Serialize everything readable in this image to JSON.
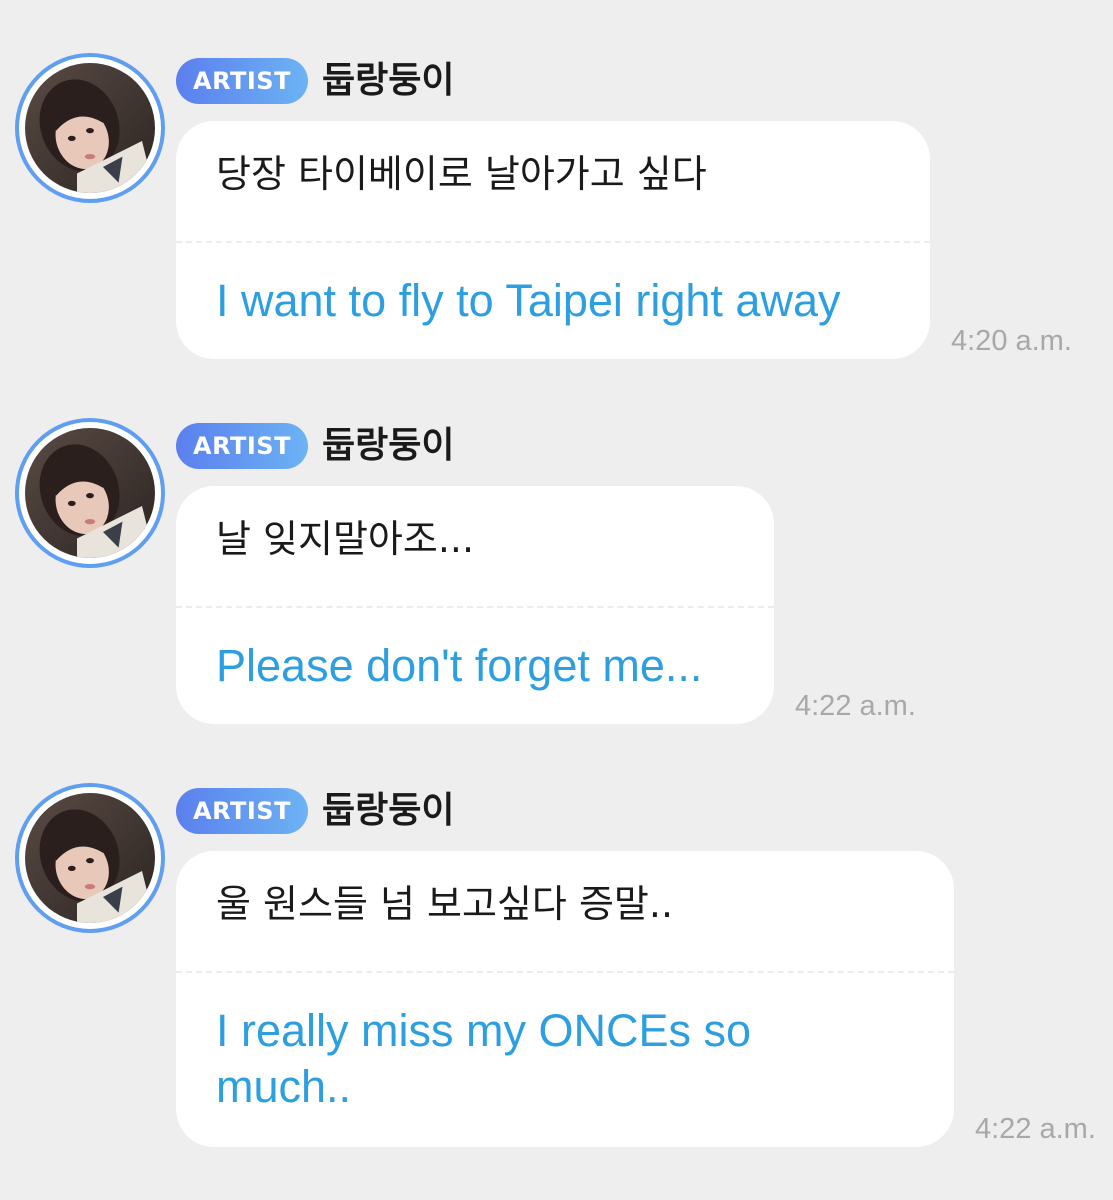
{
  "colors": {
    "background": "#eeeeee",
    "bubble": "#ffffff",
    "translation_text": "#2d9fe0",
    "timestamp": "#a8a8a8",
    "badge_gradient_start": "#5b7fee",
    "badge_gradient_end": "#6cb3f4",
    "avatar_ring": "#5f9ef0"
  },
  "messages": [
    {
      "badge": "ARTIST",
      "author": "둡랑둥이",
      "avatar_icon": "artist-avatar-photo",
      "original": "당장 타이베이로 날아가고 싶다",
      "translation": "I want to fly to Taipei right away",
      "time": "4:20 a.m."
    },
    {
      "badge": "ARTIST",
      "author": "둡랑둥이",
      "avatar_icon": "artist-avatar-photo",
      "original": "날 잊지말아조...",
      "translation": "Please don't forget me...",
      "time": "4:22 a.m."
    },
    {
      "badge": "ARTIST",
      "author": "둡랑둥이",
      "avatar_icon": "artist-avatar-photo",
      "original": "울 원스들 넘 보고싶다 증말..",
      "translation": "I really miss my ONCEs so much..",
      "time": "4:22 a.m."
    }
  ]
}
